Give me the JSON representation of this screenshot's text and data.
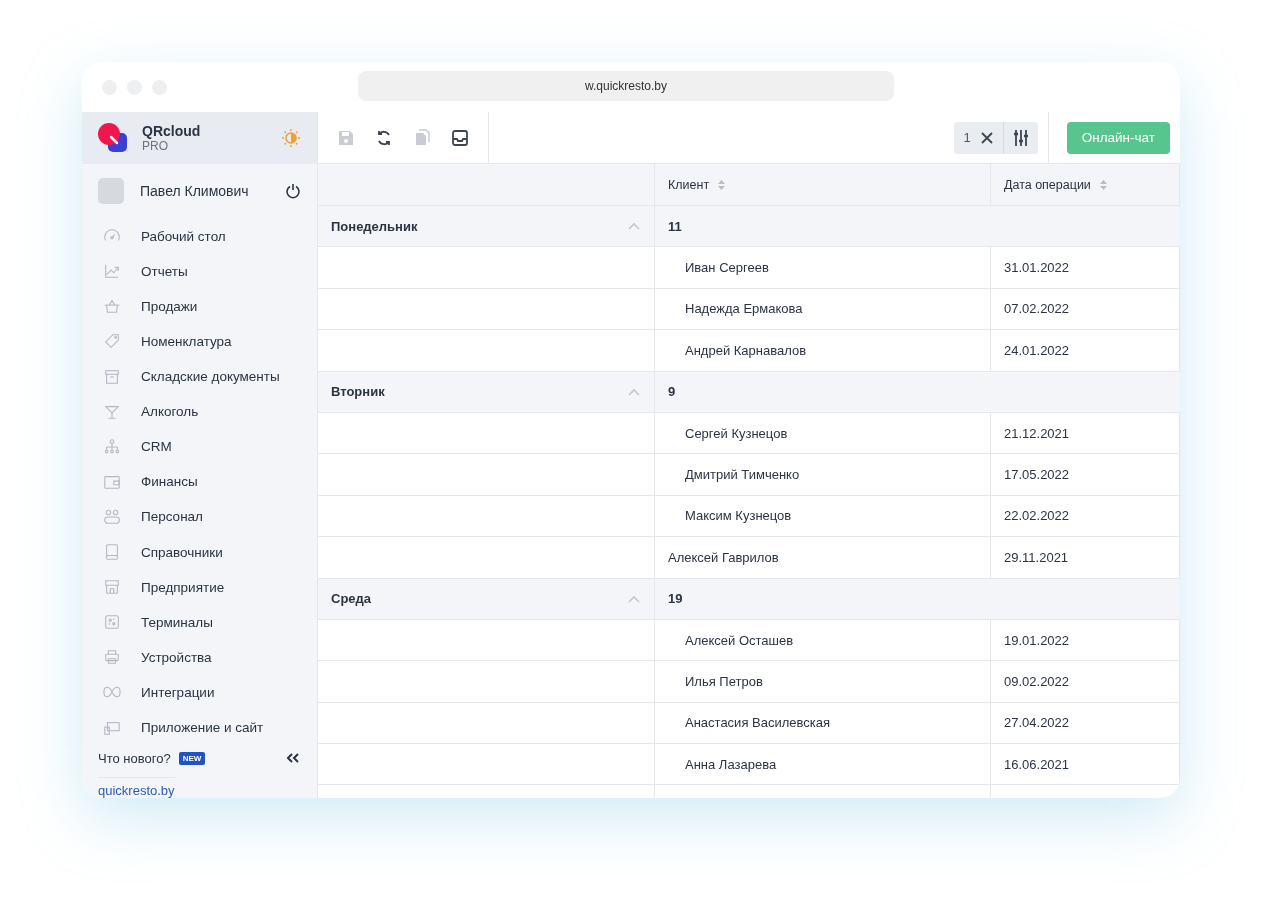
{
  "browser": {
    "url": "w.quickresto.by"
  },
  "sidebar": {
    "brand": {
      "name": "QRcloud",
      "plan": "PRO"
    },
    "user": {
      "name": "Павел Климович"
    },
    "items": [
      {
        "label": "Рабочий стол"
      },
      {
        "label": "Отчеты"
      },
      {
        "label": "Продажи"
      },
      {
        "label": "Номенклатура"
      },
      {
        "label": "Складские документы"
      },
      {
        "label": "Алкоголь"
      },
      {
        "label": "CRM"
      },
      {
        "label": "Финансы"
      },
      {
        "label": "Персонал"
      },
      {
        "label": "Справочники"
      },
      {
        "label": "Предприятие"
      },
      {
        "label": "Терминалы"
      },
      {
        "label": "Устройства"
      },
      {
        "label": "Интеграции"
      },
      {
        "label": "Приложение и сайт"
      }
    ],
    "whats_new": {
      "label": "Что нового?",
      "badge": "NEW"
    },
    "footer_link": "quickresto.by"
  },
  "toolbar": {
    "tools": [
      {
        "kind": "save",
        "disabled": true
      },
      {
        "kind": "refresh",
        "disabled": false
      },
      {
        "kind": "copy",
        "disabled": true
      },
      {
        "kind": "inbox",
        "disabled": false
      }
    ],
    "filter_count": "1",
    "chat_button": "Онлайн-чат"
  },
  "table": {
    "columns": [
      "Клиент",
      "Дата операции"
    ],
    "groups": [
      {
        "name": "Понедельник",
        "count": "11",
        "expanded": true,
        "rows": [
          {
            "client": "Иван Сергеев",
            "date": "31.01.2022",
            "indented": true
          },
          {
            "client": "Надежда Ермакова",
            "date": "07.02.2022",
            "indented": true
          },
          {
            "client": "Андрей Карнавалов",
            "date": "24.01.2022",
            "indented": true
          }
        ]
      },
      {
        "name": "Вторник",
        "count": "9",
        "expanded": true,
        "rows": [
          {
            "client": "Сергей Кузнецов",
            "date": "21.12.2021",
            "indented": true
          },
          {
            "client": "Дмитрий Тимченко",
            "date": "17.05.2022",
            "indented": true
          },
          {
            "client": "Максим Кузнецов",
            "date": "22.02.2022",
            "indented": true
          },
          {
            "client": "Алексей Гаврилов",
            "date": "29.11.2021",
            "indented": false
          }
        ]
      },
      {
        "name": "Среда",
        "count": "19",
        "expanded": true,
        "rows": [
          {
            "client": "Алексей Осташев",
            "date": "19.01.2022",
            "indented": true
          },
          {
            "client": "Илья Петров",
            "date": "09.02.2022",
            "indented": true
          },
          {
            "client": "Анастасия Василевская",
            "date": "27.04.2022",
            "indented": true
          },
          {
            "client": "Анна Лазарева",
            "date": "16.06.2021",
            "indented": true
          }
        ]
      }
    ]
  }
}
